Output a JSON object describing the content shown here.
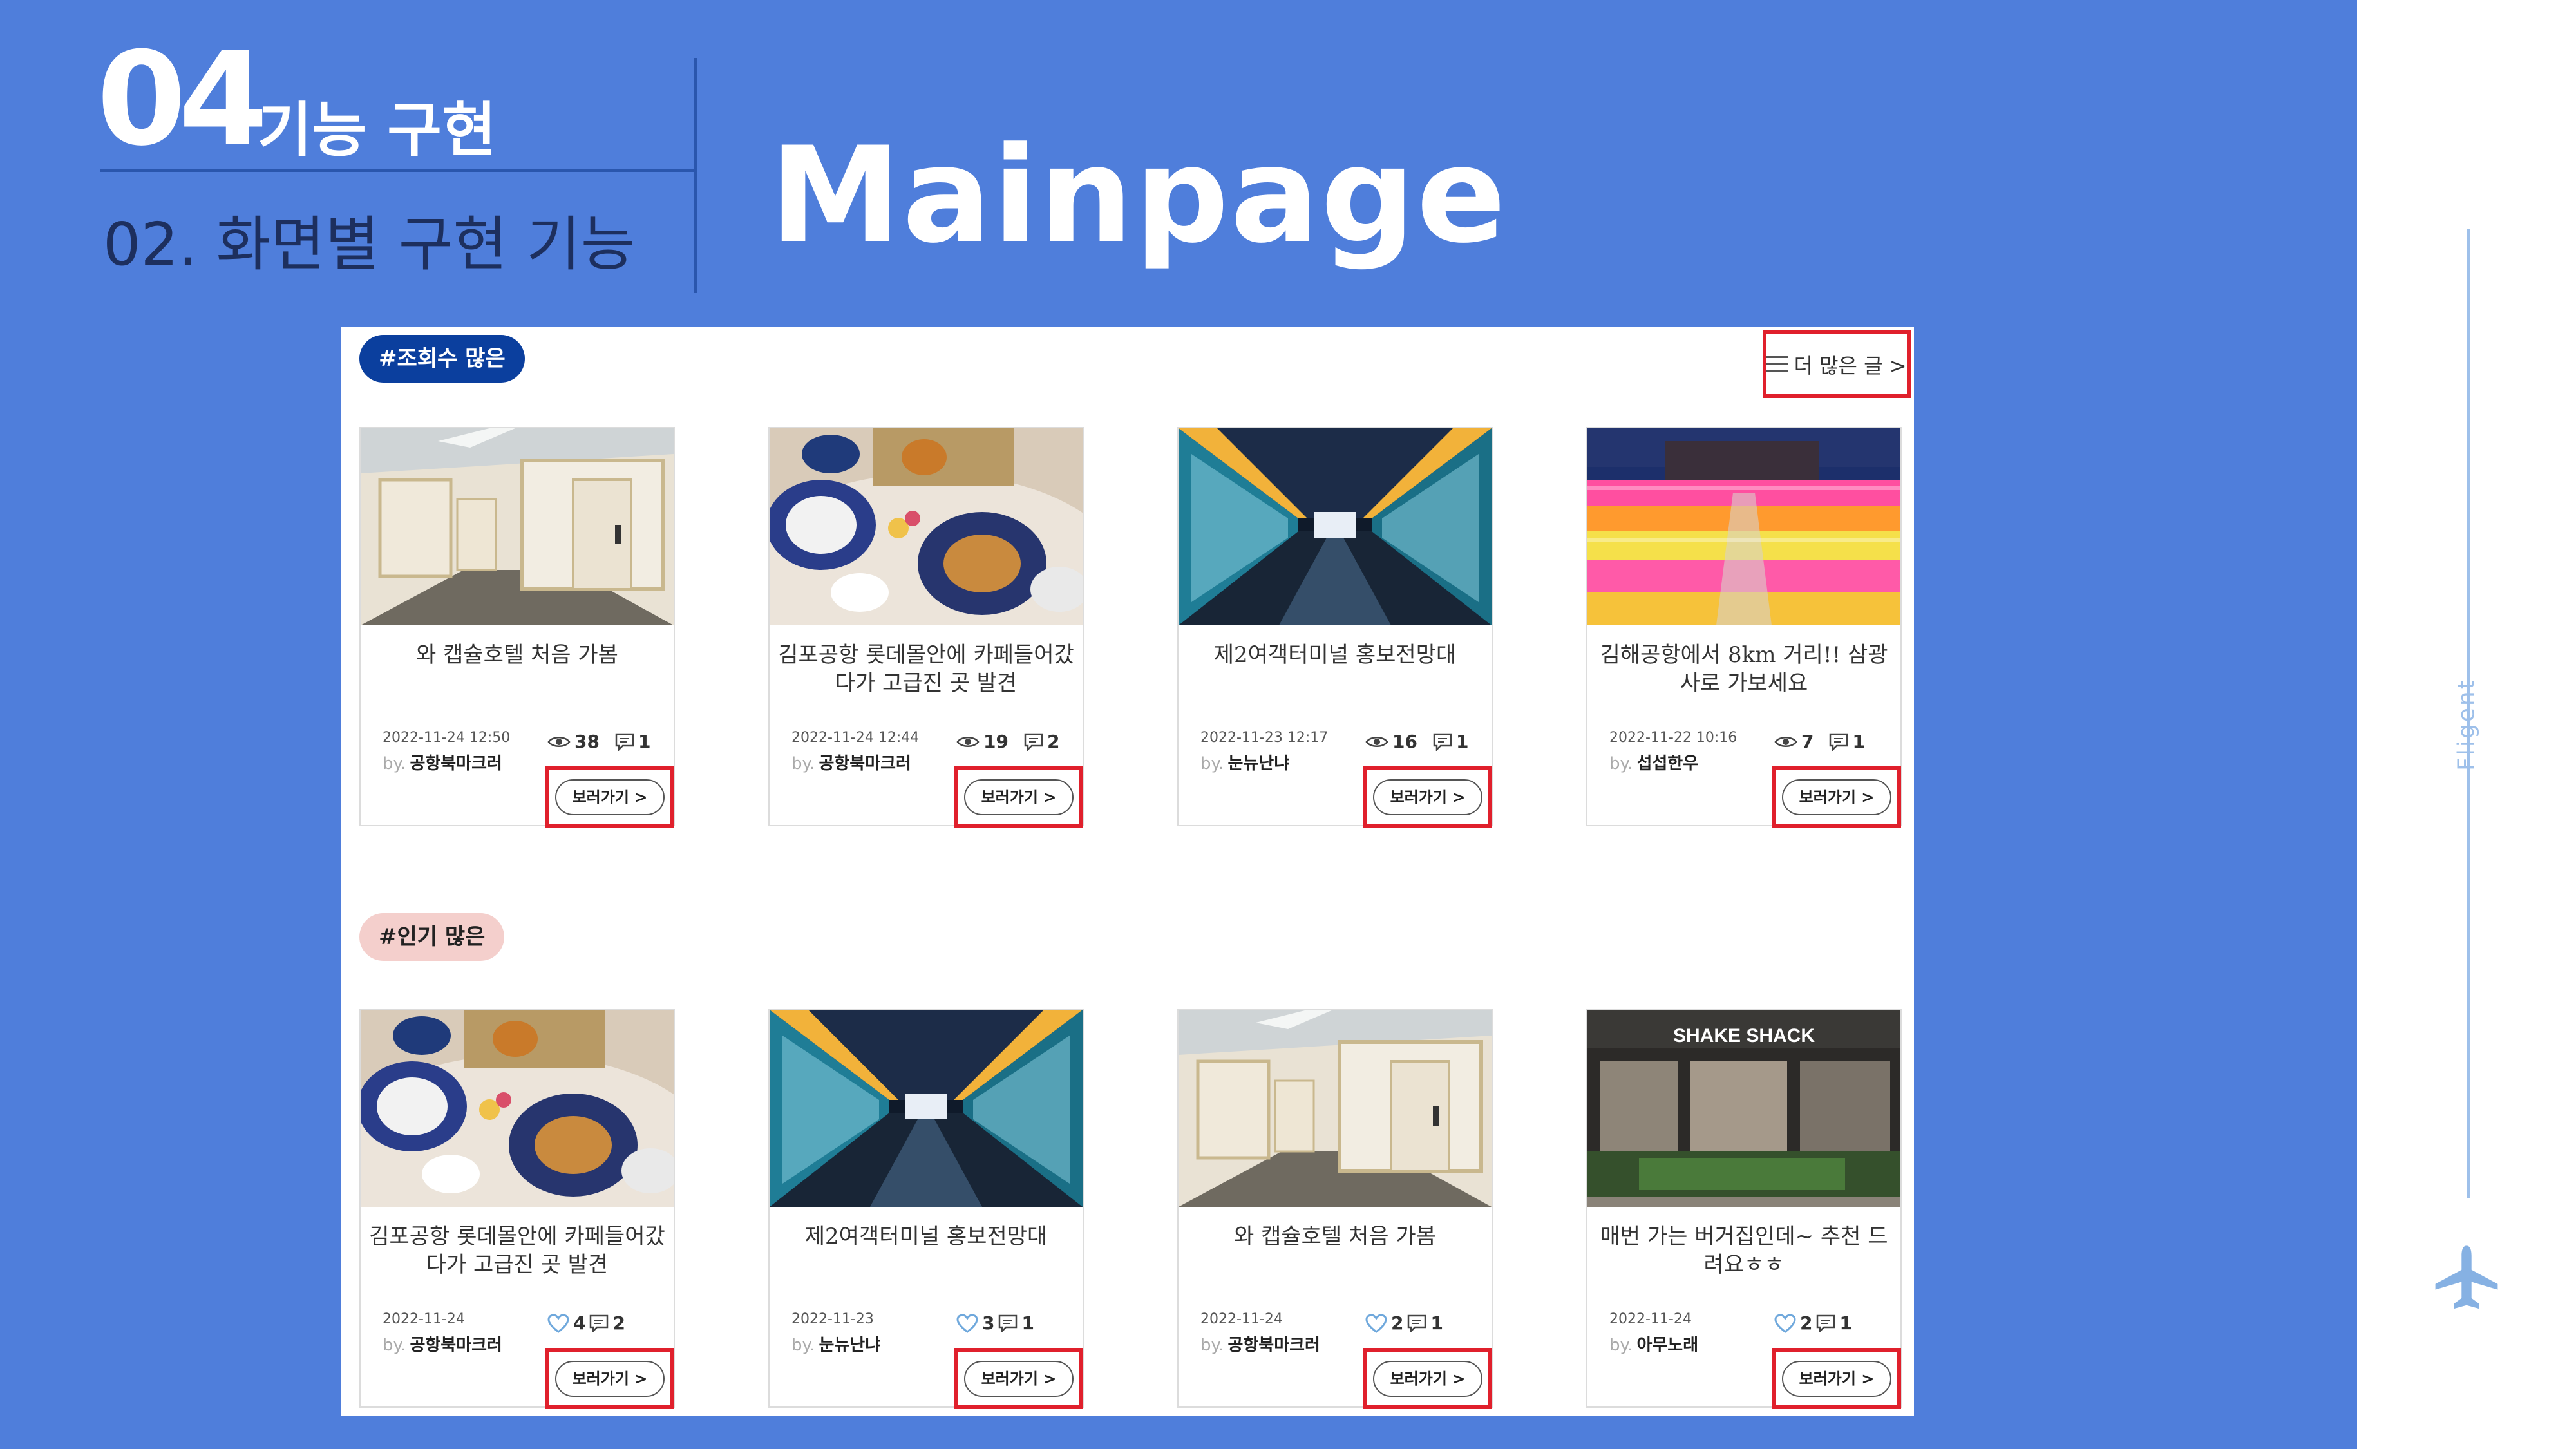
{
  "header": {
    "section_number": "04",
    "section_title": "기능 구현",
    "subtitle": "02. 화면별 구현 기능",
    "page_title": "Mainpage"
  },
  "sidebar": {
    "brand": "Fligent",
    "icon": "airplane-icon"
  },
  "screenshot": {
    "views_section": {
      "tag": "#조회수 많은",
      "more_link": "더 많은 글 >",
      "cards": [
        {
          "title": "와 캡슐호텔 처음 가봄",
          "date": "2022-11-24 12:50",
          "by_prefix": "by.",
          "author": "공항북마크러",
          "views": "38",
          "comments": "1",
          "button": "보러가기 >",
          "image": "capsule-hotel"
        },
        {
          "title": "김포공항 롯데몰안에 카페들어갔다가 고급진 곳 발견",
          "date": "2022-11-24 12:44",
          "by_prefix": "by.",
          "author": "공항북마크러",
          "views": "19",
          "comments": "2",
          "button": "보러가기 >",
          "image": "cafe-table"
        },
        {
          "title": "제2여객터미널 홍보전망대",
          "date": "2022-11-23 12:17",
          "by_prefix": "by.",
          "author": "눈뉴난냐",
          "views": "16",
          "comments": "1",
          "button": "보러가기 >",
          "image": "terminal-corridor"
        },
        {
          "title": "김해공항에서 8km 거리!! 삼광사로 가보세요",
          "date": "2022-11-22 10:16",
          "by_prefix": "by.",
          "author": "섭섭한우",
          "views": "7",
          "comments": "1",
          "button": "보러가기 >",
          "image": "lantern-temple"
        }
      ]
    },
    "popular_section": {
      "tag": "#인기 많은",
      "cards": [
        {
          "title": "김포공항 롯데몰안에 카페들어갔다가 고급진 곳 발견",
          "date": "2022-11-24",
          "by_prefix": "by.",
          "author": "공항북마크러",
          "likes": "4",
          "comments": "2",
          "button": "보러가기 >",
          "image": "cafe-table"
        },
        {
          "title": "제2여객터미널 홍보전망대",
          "date": "2022-11-23",
          "by_prefix": "by.",
          "author": "눈뉴난냐",
          "likes": "3",
          "comments": "1",
          "button": "보러가기 >",
          "image": "terminal-corridor"
        },
        {
          "title": "와 캡슐호텔 처음 가봄",
          "date": "2022-11-24",
          "by_prefix": "by.",
          "author": "공항북마크러",
          "likes": "2",
          "comments": "1",
          "button": "보러가기 >",
          "image": "capsule-hotel"
        },
        {
          "title": "매번 가는 버거집인데~ 추천 드려요ㅎㅎ",
          "date": "2022-11-24",
          "by_prefix": "by.",
          "author": "아무노래",
          "likes": "2",
          "comments": "1",
          "button": "보러가기 >",
          "image": "burger-shop",
          "sign": "SHAKE SHACK"
        }
      ]
    }
  },
  "colors": {
    "background": "#4f7edb",
    "highlight_box": "#e0202c",
    "tag_views": "#0b3f9e",
    "tag_popular": "#f4cfcc"
  }
}
